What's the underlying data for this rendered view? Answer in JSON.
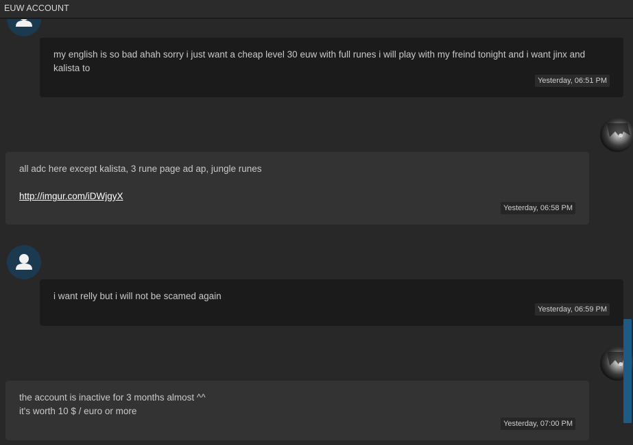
{
  "header": {
    "title": "EUW ACCOUNT"
  },
  "messages": [
    {
      "role": "buyer",
      "lines": [
        "my english is so bad ahah sorry i just want a cheap level 30 euw with full runes i will play with my freind tonight and i want jinx and kalista to"
      ],
      "timestamp": "Yesterday, 06:51 PM"
    },
    {
      "role": "seller",
      "lines": [
        "all adc here except kalista, 3 rune page ad ap, jungle runes",
        "",
        "http://imgur.com/iDWjgyX"
      ],
      "timestamp": "Yesterday, 06:58 PM"
    },
    {
      "role": "buyer",
      "lines": [
        "i want relly but i will not be scamed again"
      ],
      "timestamp": "Yesterday, 06:59 PM"
    },
    {
      "role": "seller",
      "lines": [
        "the account is inactive for 3 months almost ^^",
        "it's worth 10 $ / euro or more"
      ],
      "timestamp": "Yesterday, 07:00 PM"
    }
  ],
  "colors": {
    "background": "#282828",
    "buyer_bubble": "#1b1b1b",
    "seller_bubble": "#333333",
    "user_avatar": "#1b3a4f",
    "scrollbar": "#1f5a86"
  },
  "icons": {
    "buyer_avatar": "user-silhouette-icon",
    "seller_avatar": "anime-character-avatar"
  }
}
